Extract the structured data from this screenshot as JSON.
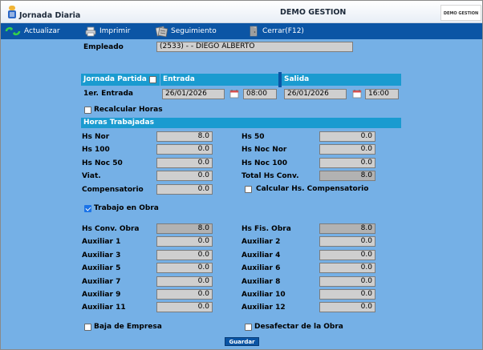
{
  "window": {
    "title": "Jornada Diaria",
    "company": "DEMO GESTION",
    "logo_text": "DEMO GESTION"
  },
  "toolbar": {
    "actualizar": "Actualizar",
    "imprimir": "Imprimir",
    "seguimiento": "Seguimiento",
    "cerrar": "Cerrar(F12)"
  },
  "empleado": {
    "label": "Empleado",
    "value": "(2533) - - DIEGO ALBERTO"
  },
  "jornada": {
    "partida_label": "Jornada Partida",
    "entrada_header": "Entrada",
    "salida_header": "Salida",
    "row_label": "1er. Entrada",
    "entrada_fecha": "26/01/2026",
    "entrada_hora": "08:00",
    "salida_fecha": "26/01/2026",
    "salida_hora": "16:00"
  },
  "recalcular_label": "Recalcular Horas",
  "horas_header": "Horas Trabajadas",
  "horas": {
    "hs_nor": {
      "label": "Hs Nor",
      "value": "8.0"
    },
    "hs_50": {
      "label": "Hs 50",
      "value": "0.0"
    },
    "hs_100": {
      "label": "Hs 100",
      "value": "0.0"
    },
    "hs_noc_nor": {
      "label": "Hs Noc Nor",
      "value": "0.0"
    },
    "hs_noc_50": {
      "label": "Hs Noc 50",
      "value": "0.0"
    },
    "hs_noc_100": {
      "label": "Hs Noc 100",
      "value": "0.0"
    },
    "viat": {
      "label": "Viat.",
      "value": "0.0"
    },
    "total_hs_conv": {
      "label": "Total Hs Conv.",
      "value": "8.0"
    },
    "compensatorio": {
      "label": "Compensatorio",
      "value": "0.0"
    },
    "calcular_comp_label": "Calcular Hs. Compensatorio"
  },
  "trabajo_obra_label": "Trabajo en Obra",
  "obra": {
    "hs_conv_obra": {
      "label": "Hs Conv. Obra",
      "value": "8.0"
    },
    "hs_fis_obra": {
      "label": "Hs Fis. Obra",
      "value": "8.0"
    },
    "aux1": {
      "label": "Auxiliar 1",
      "value": "0.0"
    },
    "aux2": {
      "label": "Auxiliar 2",
      "value": "0.0"
    },
    "aux3": {
      "label": "Auxiliar 3",
      "value": "0.0"
    },
    "aux4": {
      "label": "Auxiliar 4",
      "value": "0.0"
    },
    "aux5": {
      "label": "Auxiliar 5",
      "value": "0.0"
    },
    "aux6": {
      "label": "Auxiliar 6",
      "value": "0.0"
    },
    "aux7": {
      "label": "Auxiliar 7",
      "value": "0.0"
    },
    "aux8": {
      "label": "Auxiliar 8",
      "value": "0.0"
    },
    "aux9": {
      "label": "Auxiliar 9",
      "value": "0.0"
    },
    "aux10": {
      "label": "Auxiliar 10",
      "value": "0.0"
    },
    "aux11": {
      "label": "Auxiliar 11",
      "value": "0.0"
    },
    "aux12": {
      "label": "Auxiliar 12",
      "value": "0.0"
    }
  },
  "baja_label": "Baja de Empresa",
  "desafectar_label": "Desafectar de la Obra",
  "guardar_label": "Guardar",
  "state": {
    "jornada_partida": false,
    "recalcular": false,
    "calcular_comp": false,
    "trabajo_obra": true,
    "baja": false,
    "desafectar": false
  },
  "colors": {
    "background": "#75b0e6",
    "toolbar": "#0b55a5",
    "header_bar": "#1a9bd0",
    "field": "#cfcfcf",
    "field_dark": "#b2b2b2"
  },
  "icons": [
    "app-icon",
    "refresh-icon",
    "printer-icon",
    "tracking-icon",
    "door-icon",
    "calendar-icon"
  ]
}
